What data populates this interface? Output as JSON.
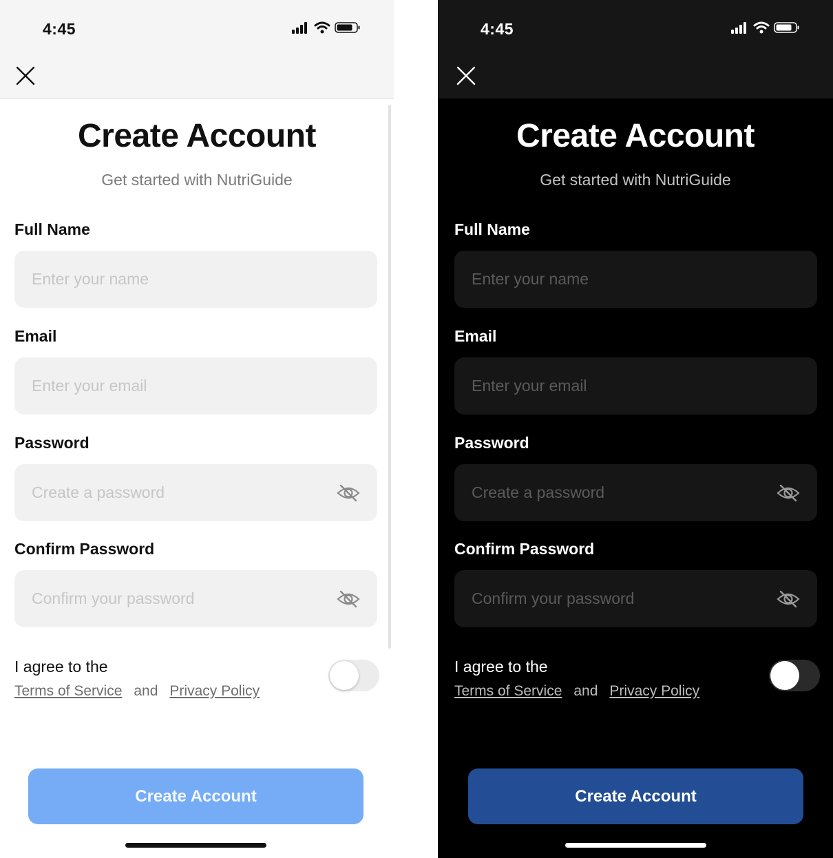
{
  "status_bar": {
    "time": "4:45"
  },
  "screen": {
    "title": "Create Account",
    "subtitle": "Get started with NutriGuide",
    "fields": {
      "full_name": {
        "label": "Full Name",
        "placeholder": "Enter your name"
      },
      "email": {
        "label": "Email",
        "placeholder": "Enter your email"
      },
      "password": {
        "label": "Password",
        "placeholder": "Create a password"
      },
      "confirm_password": {
        "label": "Confirm Password",
        "placeholder": "Confirm your password"
      }
    },
    "agree": {
      "prefix": "I agree to the",
      "terms": "Terms of Service",
      "and": "and",
      "privacy": "Privacy Policy",
      "toggle_state": "off"
    },
    "cta_label": "Create Account"
  },
  "icons": {
    "close": "close-icon",
    "eye": "eye-off-icon",
    "signal": "signal-icon",
    "wifi": "wifi-icon",
    "battery": "battery-icon"
  },
  "colors": {
    "light_cta": "#76acf6",
    "dark_cta": "#234d94",
    "light_field": "#f1f1f1",
    "dark_field": "#161616"
  }
}
